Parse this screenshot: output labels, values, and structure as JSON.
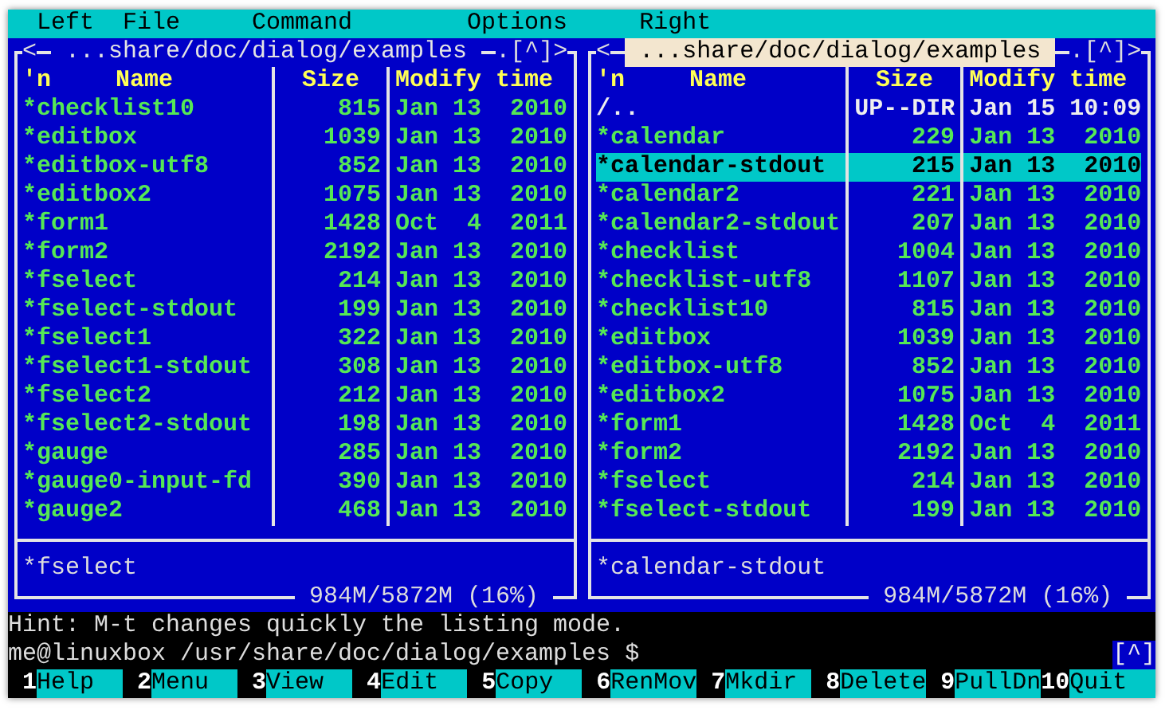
{
  "menu": [
    {
      "label": "Left"
    },
    {
      "label": "File"
    },
    {
      "label": "Command"
    },
    {
      "label": "Options"
    },
    {
      "label": "Right"
    }
  ],
  "panels": [
    {
      "active": false,
      "nav_left": "<",
      "title": "...share/doc/dialog/examples",
      "nav_right": ".[^]>",
      "columns": {
        "sort_mark": "'n",
        "name": "Name",
        "size": "Size",
        "modified": "Modify time"
      },
      "files": [
        {
          "name": "*checklist10",
          "size": "815",
          "modified": "Jan 13  2010",
          "kind": "executable",
          "selected": false
        },
        {
          "name": "*editbox",
          "size": "1039",
          "modified": "Jan 13  2010",
          "kind": "executable",
          "selected": false
        },
        {
          "name": "*editbox-utf8",
          "size": "852",
          "modified": "Jan 13  2010",
          "kind": "executable",
          "selected": false
        },
        {
          "name": "*editbox2",
          "size": "1075",
          "modified": "Jan 13  2010",
          "kind": "executable",
          "selected": false
        },
        {
          "name": "*form1",
          "size": "1428",
          "modified": "Oct  4  2011",
          "kind": "executable",
          "selected": false
        },
        {
          "name": "*form2",
          "size": "2192",
          "modified": "Jan 13  2010",
          "kind": "executable",
          "selected": false
        },
        {
          "name": "*fselect",
          "size": "214",
          "modified": "Jan 13  2010",
          "kind": "executable",
          "selected": false
        },
        {
          "name": "*fselect-stdout",
          "size": "199",
          "modified": "Jan 13  2010",
          "kind": "executable",
          "selected": false
        },
        {
          "name": "*fselect1",
          "size": "322",
          "modified": "Jan 13  2010",
          "kind": "executable",
          "selected": false
        },
        {
          "name": "*fselect1-stdout",
          "size": "308",
          "modified": "Jan 13  2010",
          "kind": "executable",
          "selected": false
        },
        {
          "name": "*fselect2",
          "size": "212",
          "modified": "Jan 13  2010",
          "kind": "executable",
          "selected": false
        },
        {
          "name": "*fselect2-stdout",
          "size": "198",
          "modified": "Jan 13  2010",
          "kind": "executable",
          "selected": false
        },
        {
          "name": "*gauge",
          "size": "285",
          "modified": "Jan 13  2010",
          "kind": "executable",
          "selected": false
        },
        {
          "name": "*gauge0-input-fd",
          "size": "390",
          "modified": "Jan 13  2010",
          "kind": "executable",
          "selected": false
        },
        {
          "name": "*gauge2",
          "size": "468",
          "modified": "Jan 13  2010",
          "kind": "executable",
          "selected": false
        }
      ],
      "status": "*fselect",
      "disk": "984M/5872M (16%)"
    },
    {
      "active": true,
      "nav_left": "<",
      "title": "...share/doc/dialog/examples",
      "nav_right": ".[^]>",
      "columns": {
        "sort_mark": "'n",
        "name": "Name",
        "size": "Size",
        "modified": "Modify time"
      },
      "files": [
        {
          "name": "/..",
          "size": "UP--DIR",
          "modified": "Jan 15 10:09",
          "kind": "directory",
          "selected": false
        },
        {
          "name": "*calendar",
          "size": "229",
          "modified": "Jan 13  2010",
          "kind": "executable",
          "selected": false
        },
        {
          "name": "*calendar-stdout",
          "size": "215",
          "modified": "Jan 13  2010",
          "kind": "executable",
          "selected": true
        },
        {
          "name": "*calendar2",
          "size": "221",
          "modified": "Jan 13  2010",
          "kind": "executable",
          "selected": false
        },
        {
          "name": "*calendar2-stdout",
          "size": "207",
          "modified": "Jan 13  2010",
          "kind": "executable",
          "selected": false
        },
        {
          "name": "*checklist",
          "size": "1004",
          "modified": "Jan 13  2010",
          "kind": "executable",
          "selected": false
        },
        {
          "name": "*checklist-utf8",
          "size": "1107",
          "modified": "Jan 13  2010",
          "kind": "executable",
          "selected": false
        },
        {
          "name": "*checklist10",
          "size": "815",
          "modified": "Jan 13  2010",
          "kind": "executable",
          "selected": false
        },
        {
          "name": "*editbox",
          "size": "1039",
          "modified": "Jan 13  2010",
          "kind": "executable",
          "selected": false
        },
        {
          "name": "*editbox-utf8",
          "size": "852",
          "modified": "Jan 13  2010",
          "kind": "executable",
          "selected": false
        },
        {
          "name": "*editbox2",
          "size": "1075",
          "modified": "Jan 13  2010",
          "kind": "executable",
          "selected": false
        },
        {
          "name": "*form1",
          "size": "1428",
          "modified": "Oct  4  2011",
          "kind": "executable",
          "selected": false
        },
        {
          "name": "*form2",
          "size": "2192",
          "modified": "Jan 13  2010",
          "kind": "executable",
          "selected": false
        },
        {
          "name": "*fselect",
          "size": "214",
          "modified": "Jan 13  2010",
          "kind": "executable",
          "selected": false
        },
        {
          "name": "*fselect-stdout",
          "size": "199",
          "modified": "Jan 13  2010",
          "kind": "executable",
          "selected": false
        }
      ],
      "status": "*calendar-stdout",
      "disk": "984M/5872M (16%)"
    }
  ],
  "hint": "Hint: M-t changes quickly the listing mode.",
  "prompt": "me@linuxbox /usr/share/doc/dialog/examples $",
  "prompt_nav": "[^]",
  "keys": [
    {
      "number": "1",
      "label": "Help"
    },
    {
      "number": "2",
      "label": "Menu"
    },
    {
      "number": "3",
      "label": "View"
    },
    {
      "number": "4",
      "label": "Edit"
    },
    {
      "number": "5",
      "label": "Copy"
    },
    {
      "number": "6",
      "label": "RenMov"
    },
    {
      "number": "7",
      "label": "Mkdir"
    },
    {
      "number": "8",
      "label": "Delete"
    },
    {
      "number": "9",
      "label": "PullDn"
    },
    {
      "number": "10",
      "label": "Quit"
    }
  ]
}
